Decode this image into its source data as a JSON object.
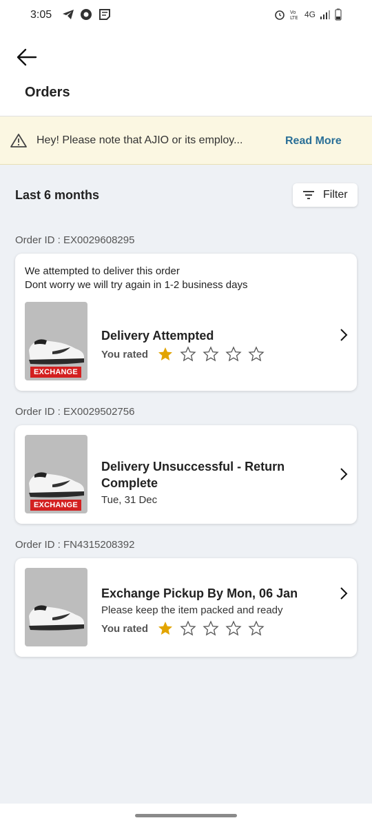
{
  "status_bar": {
    "time": "3:05",
    "network": "4G"
  },
  "header": {
    "title": "Orders"
  },
  "notice": {
    "text": "Hey! Please note that AJIO or its employ...",
    "link": "Read More"
  },
  "section": {
    "title": "Last 6 months",
    "filter_label": "Filter"
  },
  "orders": [
    {
      "order_id": "Order ID : EX0029608295",
      "message_line1": "We attempted to deliver this order",
      "message_line2": "Dont worry we will try again in 1-2 business days",
      "badge": "EXCHANGE",
      "status": "Delivery Attempted",
      "rated_label": "You rated",
      "rating": 1
    },
    {
      "order_id": "Order ID : EX0029502756",
      "badge": "EXCHANGE",
      "status_line1": "Delivery Unsuccessful - Return",
      "status_line2": "Complete",
      "date": "Tue, 31 Dec"
    },
    {
      "order_id": "Order ID : FN4315208392",
      "status": "Exchange Pickup By Mon, 06 Jan",
      "subtext": "Please keep the item packed and ready",
      "rated_label": "You rated",
      "rating": 1
    }
  ],
  "colors": {
    "accent_link": "#2a6f97",
    "badge": "#d32020",
    "star": "#e2a400",
    "notice_bg": "#fbf7e2"
  }
}
